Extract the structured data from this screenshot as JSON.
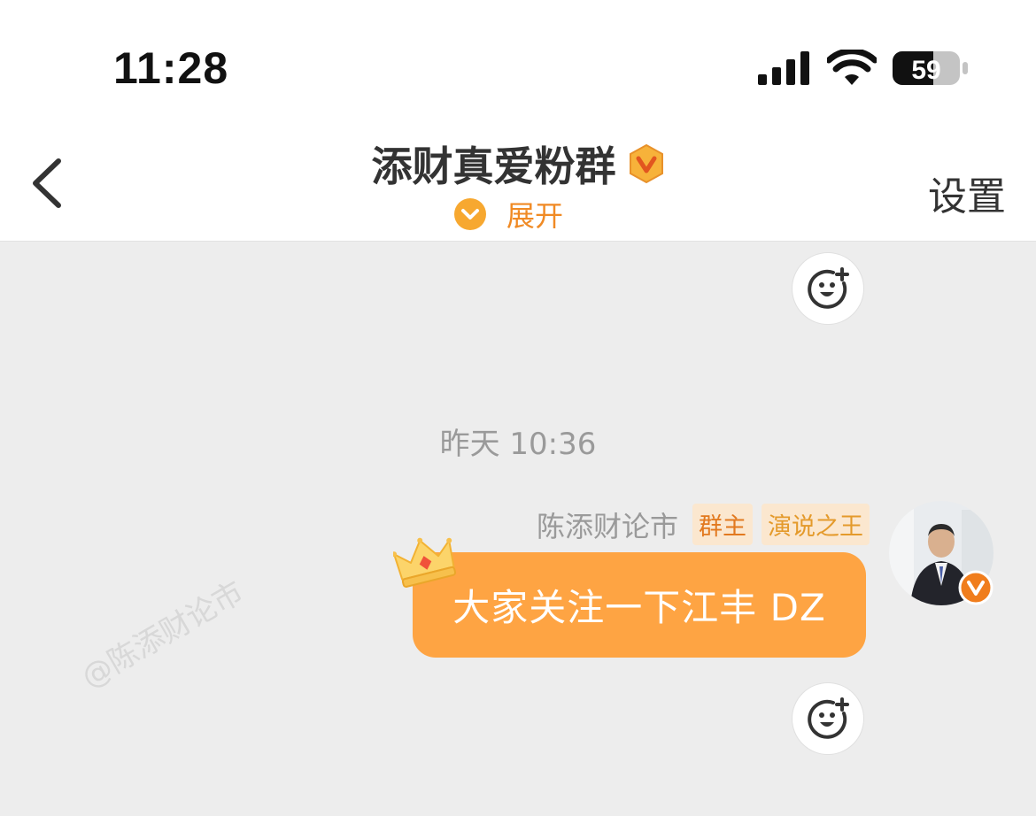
{
  "status_bar": {
    "time": "11:28",
    "battery_level": "59"
  },
  "nav": {
    "back_icon": "chevron-left-icon",
    "title": "添财真爱粉群",
    "title_badge_icon": "vip-v-badge-icon",
    "expand_label": "展开",
    "settings_label": "设置"
  },
  "watermark": {
    "text": "@陈添财论市"
  },
  "chat": {
    "timestamp": "昨天 10:36",
    "messages": [
      {
        "sender": "陈添财论市",
        "tags": [
          "群主",
          "演说之王"
        ],
        "text": "大家关注一下江丰 DZ",
        "avatar_icon": "user-avatar",
        "decoration_icon": "crown-icon"
      }
    ],
    "reaction_icon": "add-emoji-reaction-icon"
  },
  "colors": {
    "accent": "#f08a24",
    "bubble": "#fea443",
    "background": "#ededed",
    "tag_bg": "#fbe7cf"
  }
}
